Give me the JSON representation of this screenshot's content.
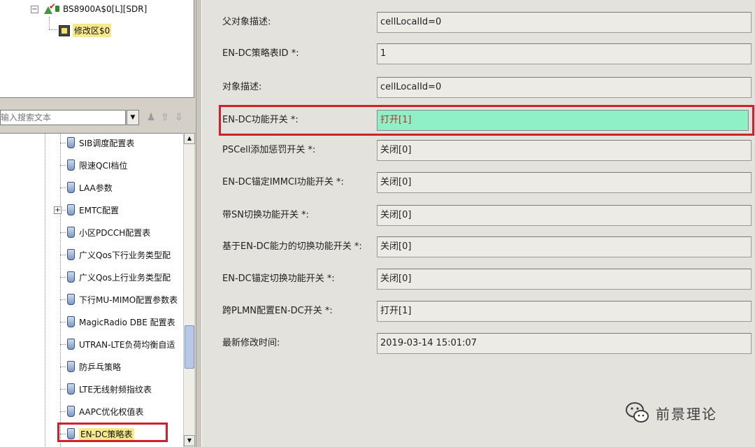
{
  "tree_top": {
    "node1_label": "BS8900A$0[L][SDR]",
    "node2_label": "修改区$0",
    "expander_minus": "−"
  },
  "search": {
    "placeholder": "输入搜索文本",
    "dropdown_glyph": "▼",
    "btn_find": "♟",
    "btn_up": "⇧",
    "btn_down": "⇩"
  },
  "tree_items": [
    "SIB调度配置表",
    "限速QCI档位",
    "LAA参数",
    "EMTC配置",
    "小区PDCCH配置表",
    "广义Qos下行业务类型配",
    "广义Qos上行业务类型配",
    "下行MU-MIMO配置参数表",
    "MagicRadio DBE 配置表",
    "UTRAN-LTE负荷均衡自适",
    "防乒乓策略",
    "LTE无线射频指纹表",
    "AAPC优化权值表",
    "EN-DC策略表"
  ],
  "tree_plus": "+",
  "scroll": {
    "up": "▲",
    "down": "▼"
  },
  "properties": [
    {
      "label": "父对象描述:",
      "value": "cellLocalId=0"
    },
    {
      "label": "EN-DC策略表ID *:",
      "value": "1"
    },
    {
      "label": "对象描述:",
      "value": "cellLocalId=0"
    },
    {
      "label": "EN-DC功能开关 *:",
      "value": "打开[1]"
    },
    {
      "label": "PSCell添加惩罚开关 *:",
      "value": "关闭[0]"
    },
    {
      "label": "EN-DC锚定IMMCI功能开关 *:",
      "value": "关闭[0]"
    },
    {
      "label": "带SN切换功能开关 *:",
      "value": "关闭[0]"
    },
    {
      "label": "基于EN-DC能力的切换功能开关 *:",
      "value": "关闭[0]"
    },
    {
      "label": "EN-DC锚定切换功能开关 *:",
      "value": "关闭[0]"
    },
    {
      "label": "跨PLMN配置EN-DC开关 *:",
      "value": "打开[1]"
    },
    {
      "label": "最新修改时间:",
      "value": "2019-03-14 15:01:07"
    }
  ],
  "watermark": {
    "text": "前景理论"
  },
  "colors": {
    "highlight_border": "#d2202a",
    "switch_field_bg": "#8ff0c8",
    "selected_label_bg": "#f7e98a"
  }
}
